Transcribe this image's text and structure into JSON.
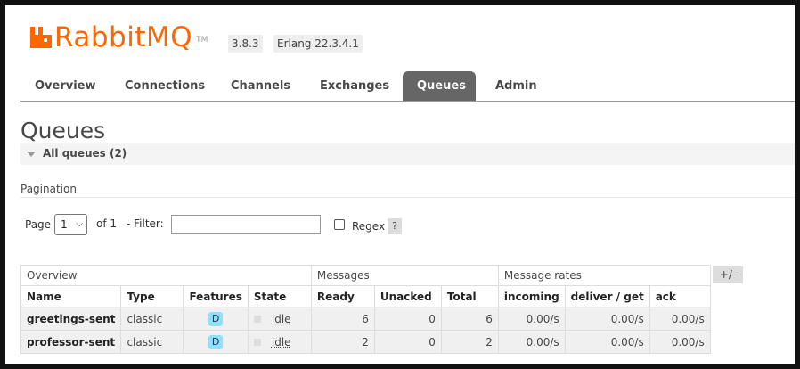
{
  "header": {
    "logo_text": "RabbitMQ",
    "logo_tm": "TM",
    "version": "3.8.3",
    "erlang": "Erlang 22.3.4.1",
    "brand_color": "#ff6600"
  },
  "tabs": [
    {
      "label": "Overview"
    },
    {
      "label": "Connections"
    },
    {
      "label": "Channels"
    },
    {
      "label": "Exchanges"
    },
    {
      "label": "Queues",
      "active": true
    },
    {
      "label": "Admin"
    }
  ],
  "main": {
    "title": "Queues",
    "section_label": "All queues (2)",
    "pagination_title": "Pagination",
    "page_label": "Page",
    "page_value": "1",
    "of_label": "of 1",
    "filter_label": "- Filter:",
    "filter_value": "",
    "regex_label": "Regex",
    "help_label": "?",
    "columns_toggle": "+/-"
  },
  "table": {
    "groups": [
      "Overview",
      "Messages",
      "Message rates"
    ],
    "headers": [
      "Name",
      "Type",
      "Features",
      "State",
      "Ready",
      "Unacked",
      "Total",
      "incoming",
      "deliver / get",
      "ack"
    ],
    "rows": [
      {
        "name": "greetings-sent",
        "type": "classic",
        "features": "D",
        "state": "idle",
        "ready": "6",
        "unacked": "0",
        "total": "6",
        "incoming": "0.00/s",
        "deliver": "0.00/s",
        "ack": "0.00/s"
      },
      {
        "name": "professor-sent",
        "type": "classic",
        "features": "D",
        "state": "idle",
        "ready": "2",
        "unacked": "0",
        "total": "2",
        "incoming": "0.00/s",
        "deliver": "0.00/s",
        "ack": "0.00/s"
      }
    ]
  }
}
